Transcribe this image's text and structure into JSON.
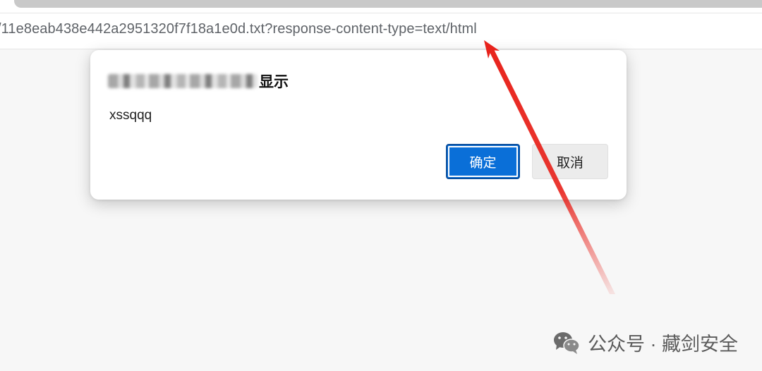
{
  "browser": {
    "address_url": "/11e8eab438e442a2951320f7f18a1e0d.txt?response-content-type=text/html"
  },
  "dialog": {
    "title": "显示",
    "message": "xssqqq",
    "ok_label": "确定",
    "cancel_label": "取消"
  },
  "annotation": {
    "arrow_color": "#e8231c"
  },
  "watermark": {
    "text": "公众号 · 藏剑安全",
    "icon": "wechat-icon"
  }
}
